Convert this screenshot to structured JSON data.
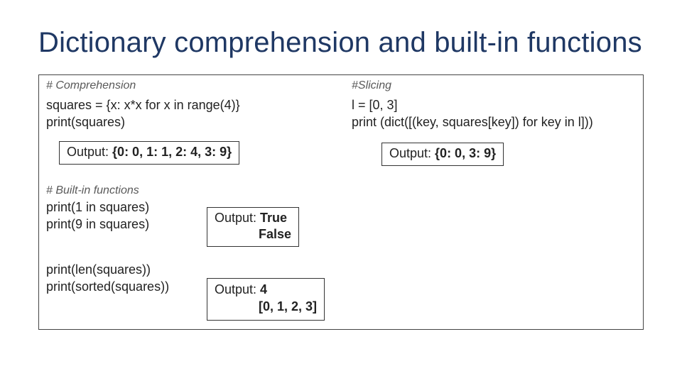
{
  "title": "Dictionary comprehension and built-in functions",
  "left": {
    "comprehension": {
      "comment": "# Comprehension",
      "line1": "squares = {x: x*x for x in range(4)}",
      "line2": "print(squares)",
      "output_label": "Output: ",
      "output_value": "{0: 0, 1: 1, 2: 4, 3: 9}"
    },
    "builtin": {
      "comment": "# Built-in functions",
      "line1": "print(1 in squares)",
      "line2": "print(9 in squares)",
      "output_label": "Output:  ",
      "output_v1": "True",
      "output_v2": "False"
    },
    "lensort": {
      "line1": "print(len(squares))",
      "line2": "print(sorted(squares))",
      "output_label": "Output:   ",
      "output_v1": "4",
      "output_v2": "[0, 1, 2, 3]"
    }
  },
  "right": {
    "slicing": {
      "comment": "#Slicing",
      "line1": "l = [0, 3]",
      "line2": "print (dict([(key, squares[key]) for key in l]))",
      "output_label": "Output: ",
      "output_value": "{0: 0, 3: 9}"
    }
  }
}
